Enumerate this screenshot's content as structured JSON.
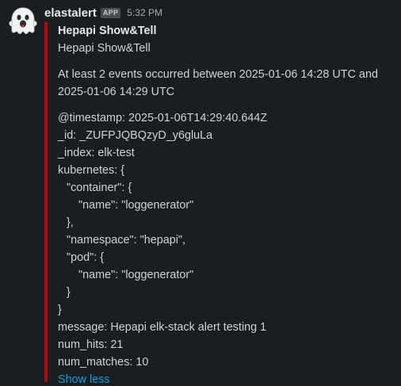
{
  "message": {
    "sender": "elastalert",
    "badge": "APP",
    "time": "5:32 PM",
    "avatar_icon": "ghost-icon",
    "accent_color": "#b00a0a"
  },
  "attachment": {
    "title": "Hepapi Show&Tell",
    "pretext": "Hepapi Show&Tell",
    "summary": "At least 2 events occurred between 2025-01-06 14:28 UTC and 2025-01-06 14:29 UTC",
    "lines": [
      {
        "text": "@timestamp: 2025-01-06T14:29:40.644Z",
        "indent": 0
      },
      {
        "text": "_id: _ZUFPJQBQzyD_y6gluLa",
        "indent": 0
      },
      {
        "text": "_index: elk-test",
        "indent": 0
      },
      {
        "text": "kubernetes: {",
        "indent": 0
      },
      {
        "text": "\"container\": {",
        "indent": 1
      },
      {
        "text": "\"name\": \"loggenerator\"",
        "indent": 2
      },
      {
        "text": "},",
        "indent": 1
      },
      {
        "text": "\"namespace\": \"hepapi\",",
        "indent": 1
      },
      {
        "text": "\"pod\": {",
        "indent": 1
      },
      {
        "text": "\"name\": \"loggenerator\"",
        "indent": 2
      },
      {
        "text": "}",
        "indent": 1
      },
      {
        "text": "}",
        "indent": 0
      },
      {
        "text": "message: Hepapi elk-stack alert testing 1",
        "indent": 0
      },
      {
        "text": "num_hits: 21",
        "indent": 0
      },
      {
        "text": "num_matches: 10",
        "indent": 0
      }
    ],
    "show_less": "Show less",
    "link_color": "#1d9bd1"
  }
}
